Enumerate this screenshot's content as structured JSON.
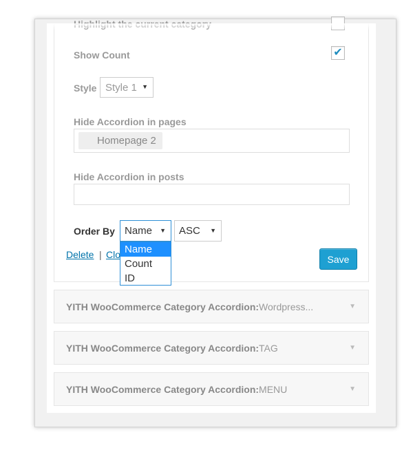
{
  "widget_form": {
    "highlight_label": "Highlight the current category",
    "show_count_label": "Show Count",
    "show_count_checked": true,
    "style_label": "Style",
    "style_value": "Style 1",
    "hide_pages_label": "Hide Accordion in pages",
    "hide_pages_chip": "Homepage 2",
    "hide_posts_label": "Hide Accordion in posts",
    "order_by_label": "Order By",
    "order_by_value": "Name",
    "order_by_options": [
      "Name",
      "Count",
      "ID"
    ],
    "order_dir_value": "ASC",
    "delete_link": "Delete",
    "separator": "|",
    "close_link": "Clo",
    "save_button": "Save"
  },
  "accordions": [
    {
      "title": "YITH WooCommerce Category Accordion:",
      "suffix": " Wordpress..."
    },
    {
      "title": "YITH WooCommerce Category Accordion:",
      "suffix": " TAG"
    },
    {
      "title": "YITH WooCommerce Category Accordion:",
      "suffix": " MENU"
    }
  ],
  "icons": {
    "checkmark": "✔",
    "caret": "▼"
  },
  "colors": {
    "accent": "#1ea0d2",
    "link": "#0073aa",
    "selected_option": "#1e90ff"
  }
}
